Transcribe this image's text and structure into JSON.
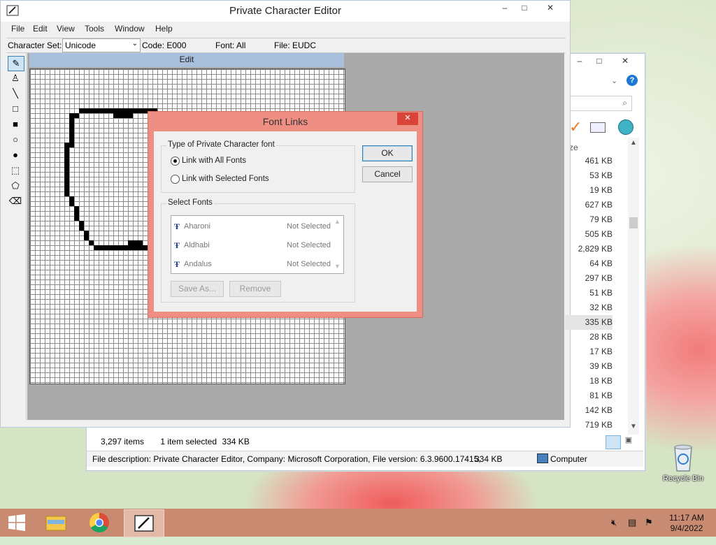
{
  "pce": {
    "title": "Private Character Editor",
    "menu": [
      "File",
      "Edit",
      "View",
      "Tools",
      "Window",
      "Help"
    ],
    "infobar": {
      "charset_label": "Character Set:",
      "charset_value": "Unicode",
      "code": "Code: E000",
      "font": "Font: All",
      "file": "File: EUDC"
    },
    "edit_header": "Edit",
    "tools": [
      "pencil-icon",
      "brush-icon",
      "line-icon",
      "hollow-rectangle-icon",
      "filled-rectangle-icon",
      "hollow-ellipse-icon",
      "filled-ellipse-icon",
      "rectangular-select-icon",
      "freeform-select-icon",
      "eraser-icon"
    ]
  },
  "dialog": {
    "title": "Font Links",
    "type_group": "Type of Private Character font",
    "radio_all": "Link with All Fonts",
    "radio_selected": "Link with Selected Fonts",
    "radio_checked": "all",
    "ok": "OK",
    "cancel": "Cancel",
    "select_group": "Select Fonts",
    "fonts": [
      {
        "name": "Aharoni",
        "status": "Not Selected"
      },
      {
        "name": "Aldhabi",
        "status": "Not Selected"
      },
      {
        "name": "Andalus",
        "status": "Not Selected"
      }
    ],
    "save_as": "Save As...",
    "remove": "Remove"
  },
  "explorer": {
    "column_header": "ze",
    "sizes": [
      "461 KB",
      "53 KB",
      "19 KB",
      "627 KB",
      "79 KB",
      "505 KB",
      "2,829 KB",
      "64 KB",
      "297 KB",
      "51 KB",
      "32 KB",
      "335 KB",
      "28 KB",
      "17 KB",
      "39 KB",
      "18 KB",
      "81 KB",
      "142 KB",
      "719 KB"
    ],
    "selected_index": 11,
    "item_count": "3,297 items",
    "selection": "1 item selected",
    "selection_size": "334 KB",
    "file_description": "File description: Private Character Editor, Company: Microsoft Corporation, File version: 6.3.9600.17415,",
    "desc_size": "334 KB",
    "location": "Computer"
  },
  "desktop": {
    "recycle_bin": "Recycle Bin"
  },
  "taskbar": {
    "time": "11:17 AM",
    "date": "9/4/2022"
  },
  "colors": {
    "dialog_frame": "#ef8f84",
    "taskbar": "#c98a72",
    "edit_header": "#a9c0dc",
    "close_button": "#d9443a"
  }
}
